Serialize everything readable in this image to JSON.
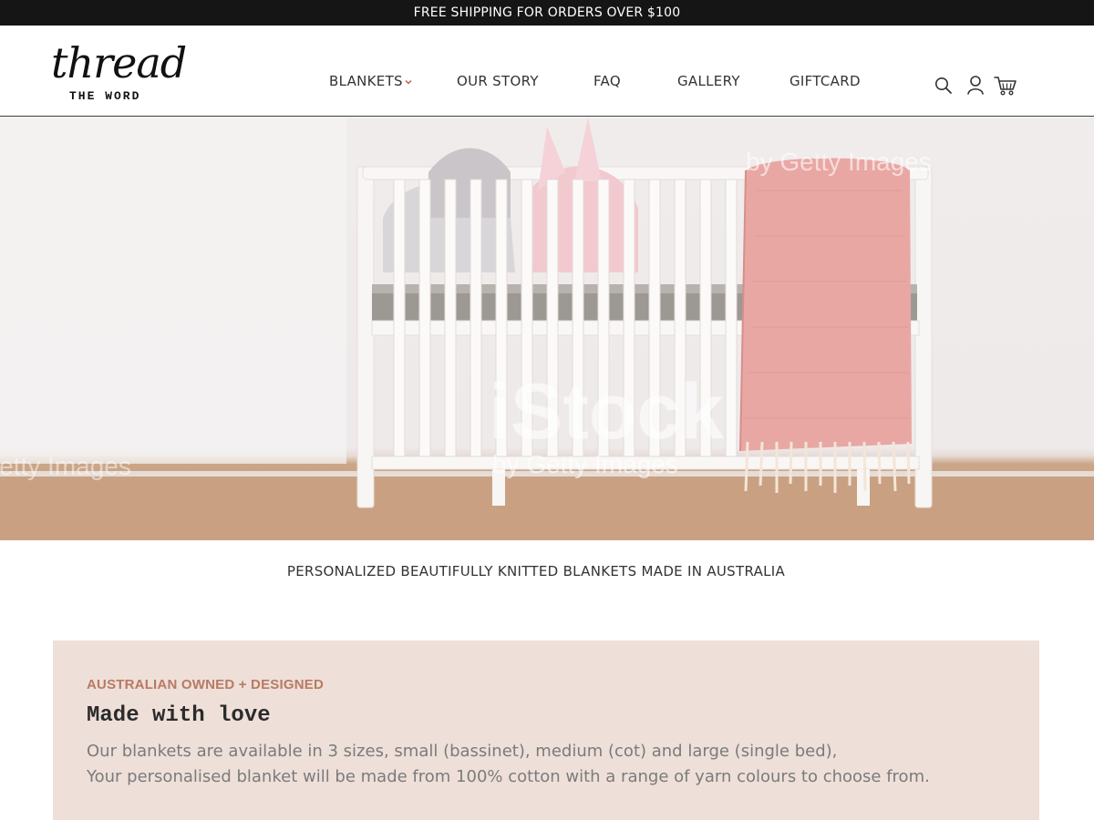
{
  "announcement": {
    "text": "FREE SHIPPING FOR ORDERS OVER $100"
  },
  "logo": {
    "script": "thread",
    "sub": "THE WORD"
  },
  "nav": {
    "items": [
      {
        "label": "BLANKETS",
        "has_dropdown": true
      },
      {
        "label": "OUR STORY"
      },
      {
        "label": "FAQ"
      },
      {
        "label": "GALLERY"
      },
      {
        "label": "GIFTCARD"
      }
    ],
    "accent_color": "#c0735c"
  },
  "header_icons": [
    "search-icon",
    "account-icon",
    "cart-icon"
  ],
  "hero": {
    "watermark_main": "iStock",
    "watermark_sub": "by Getty Images",
    "blanket_color": "#e9a7a4"
  },
  "tagline": "PERSONALIZED BEAUTIFULLY KNITTED BLANKETS MADE IN AUSTRALIA",
  "promo": {
    "kicker": "AUSTRALIAN OWNED + DESIGNED",
    "title": "Made with love",
    "lines": [
      "Our blankets are available in 3 sizes, small (bassinet), medium (cot) and large (single bed),",
      "Your personalised blanket will be made from 100% cotton with a range of yarn colours to choose from."
    ],
    "background": "#eedfd9",
    "kicker_color": "#b97a62"
  }
}
